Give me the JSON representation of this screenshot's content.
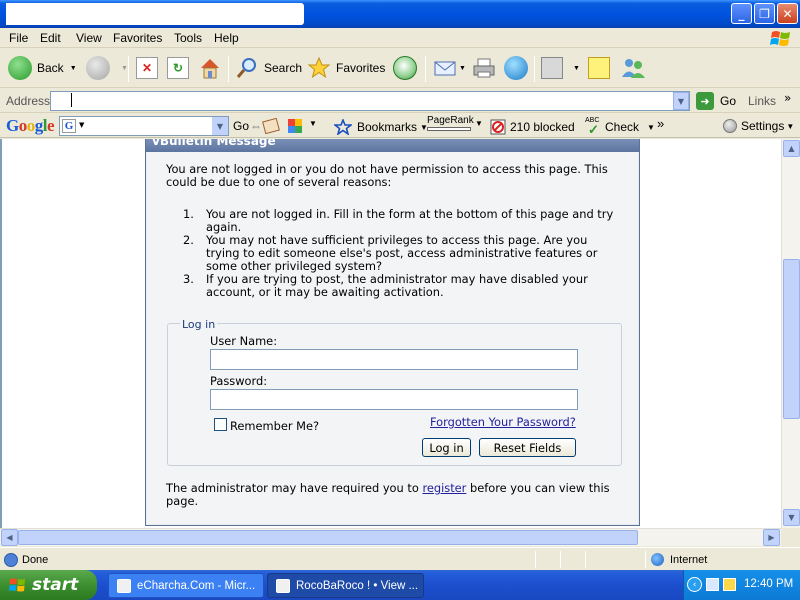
{
  "window": {
    "controls": {
      "minimize": "_",
      "maximize": "❐",
      "close": "✕"
    }
  },
  "menu": {
    "items": [
      "File",
      "Edit",
      "View",
      "Favorites",
      "Tools",
      "Help"
    ]
  },
  "toolbar": {
    "back": "Back",
    "search": "Search",
    "favorites": "Favorites",
    "icons": [
      "back-icon",
      "forward-icon",
      "stop-icon",
      "refresh-icon",
      "home-icon",
      "search-icon",
      "favorites-icon",
      "history-icon",
      "mail-icon",
      "print-icon",
      "messenger-icon",
      "research-icon",
      "notes-icon",
      "people-icon"
    ]
  },
  "address": {
    "label": "Address",
    "value": "",
    "go": "Go",
    "links": "Links",
    "chevron": "»"
  },
  "google": {
    "logo": "Google",
    "search_badge": "G",
    "go": "Go",
    "bookmarks": "Bookmarks",
    "pagerank": "PageRank",
    "blocked": "210 blocked",
    "check_abc": "ABC",
    "check": "Check",
    "chevron": "»",
    "settings": "Settings"
  },
  "page": {
    "panel_title": "vBulletin Message",
    "intro": "You are not logged in or you do not have permission to access this page. This could be due to one of several reasons:",
    "reasons": [
      {
        "num": "1.",
        "text": "You are not logged in. Fill in the form at the bottom of this page and try again."
      },
      {
        "num": "2.",
        "text": "You may not have sufficient privileges to access this page. Are you trying to edit someone else's post, access administrative features or some other privileged system?"
      },
      {
        "num": "3.",
        "text": "If you are trying to post, the administrator may have disabled your account, or it may be awaiting activation."
      }
    ],
    "login": {
      "legend": "Log in",
      "username_label": "User Name:",
      "username_value": "",
      "password_label": "Password:",
      "password_value": "",
      "remember_label": "Remember Me?",
      "remember_checked": false,
      "forgot_link": "Forgotten Your Password?",
      "login_button": "Log in",
      "reset_button": "Reset Fields"
    },
    "footer_before": "The administrator may have required you to ",
    "footer_link": "register",
    "footer_after": " before you can view this page."
  },
  "status": {
    "text": "Done",
    "zone": "Internet"
  },
  "taskbar": {
    "start": "start",
    "tasks": [
      {
        "label": "eCharcha.Com - Micr...",
        "active": false
      },
      {
        "label": "RocoBaRoco ! • View ...",
        "active": true
      }
    ],
    "clock": "12:40 PM"
  },
  "colors": {
    "titlebar": "#0053e0",
    "taskbar": "#1c4fcd",
    "start_button": "#3c8f2f",
    "link": "#22229c",
    "panel_header": "#5c74a0"
  }
}
